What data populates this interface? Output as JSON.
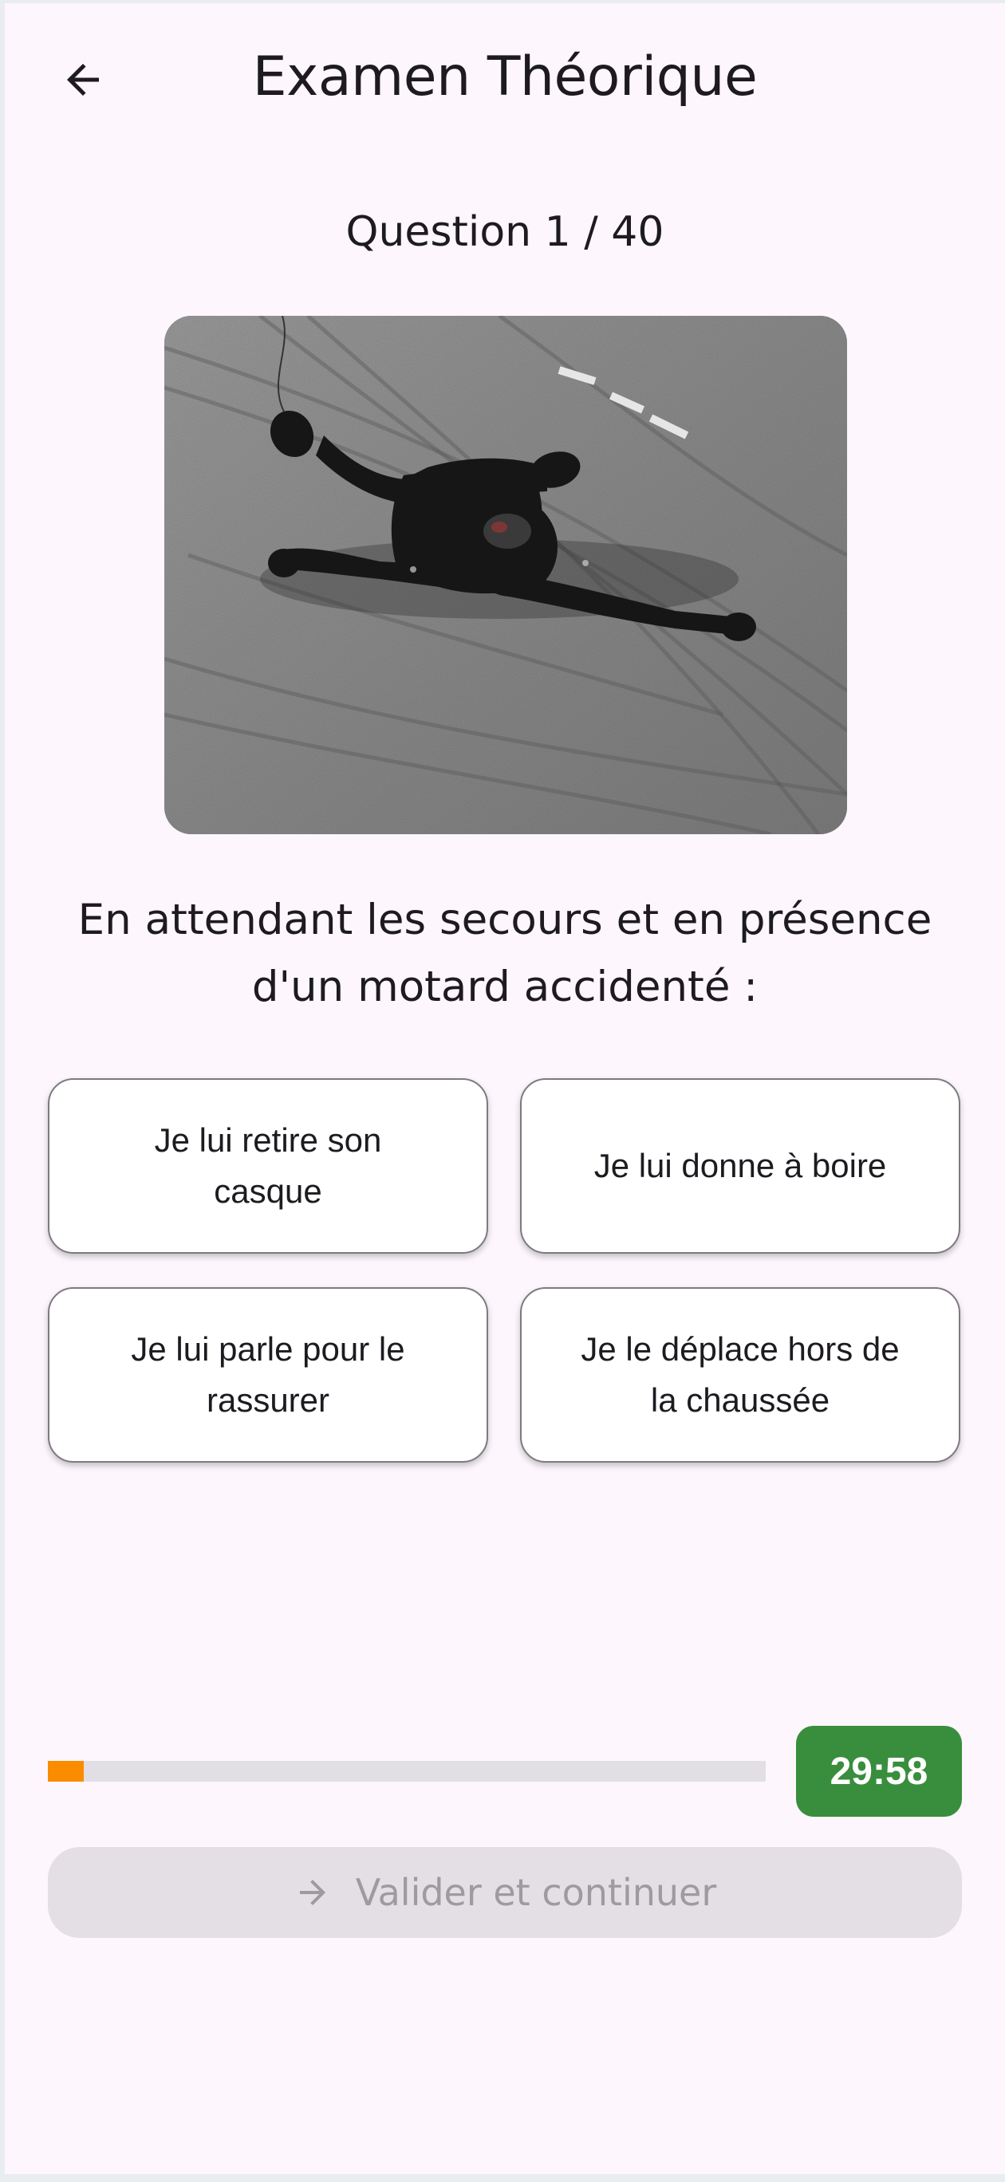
{
  "app_bar": {
    "title": "Examen Théorique",
    "back_icon": "arrow-left-icon"
  },
  "quiz": {
    "counter": "Question 1 / 40",
    "question_text": "En attendant les secours et en présence d'un motard accidenté :",
    "answers": [
      {
        "label": "Je lui retire son casque"
      },
      {
        "label": "Je lui donne à boire"
      },
      {
        "label": "Je lui parle pour le rassurer"
      },
      {
        "label": "Je le déplace hors de la chaussée"
      }
    ]
  },
  "progress": {
    "fraction": 0.05,
    "fill_color": "#fb8c00",
    "timer": "29:58",
    "timer_color": "#388e3c"
  },
  "actions": {
    "validate_label": "Valider et continuer",
    "validate_icon": "arrow-right-icon",
    "validate_enabled": false
  }
}
